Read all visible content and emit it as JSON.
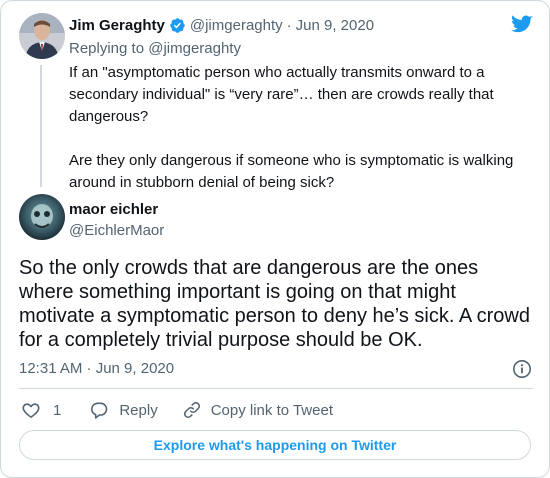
{
  "quoted_tweet": {
    "author_name": "Jim Geraghty",
    "handle": "@jimgeraghty",
    "separator": "·",
    "date": "Jun 9, 2020",
    "replying_to": "Replying to @jimgeraghty",
    "paragraphs": [
      "If an \"asymptomatic person who actually transmits onward to a secondary individual\" is “very rare”… then are crowds really that dangerous?",
      "Are they only dangerous if someone who is symptomatic is walking around in stubborn denial of being sick?"
    ]
  },
  "main_tweet": {
    "author_name": "maor eichler",
    "handle": "@EichlerMaor",
    "text": "So the only crowds that are dangerous are the ones where something important is going on that might motivate a symptomatic person to deny he’s sick. A crowd for a completely trivial purpose should be OK.",
    "timestamp": "12:31 AM · Jun 9, 2020"
  },
  "actions": {
    "like_count": "1",
    "reply_label": "Reply",
    "copy_link_label": "Copy link to Tweet"
  },
  "explore_label": "Explore what's happening on Twitter",
  "colors": {
    "brand": "#1d9bf0",
    "text": "#0f1419",
    "muted": "#536471",
    "border": "#cfd9de"
  },
  "icons": [
    "verified-badge-icon",
    "twitter-logo-icon",
    "info-icon",
    "heart-icon",
    "reply-icon",
    "link-icon"
  ]
}
